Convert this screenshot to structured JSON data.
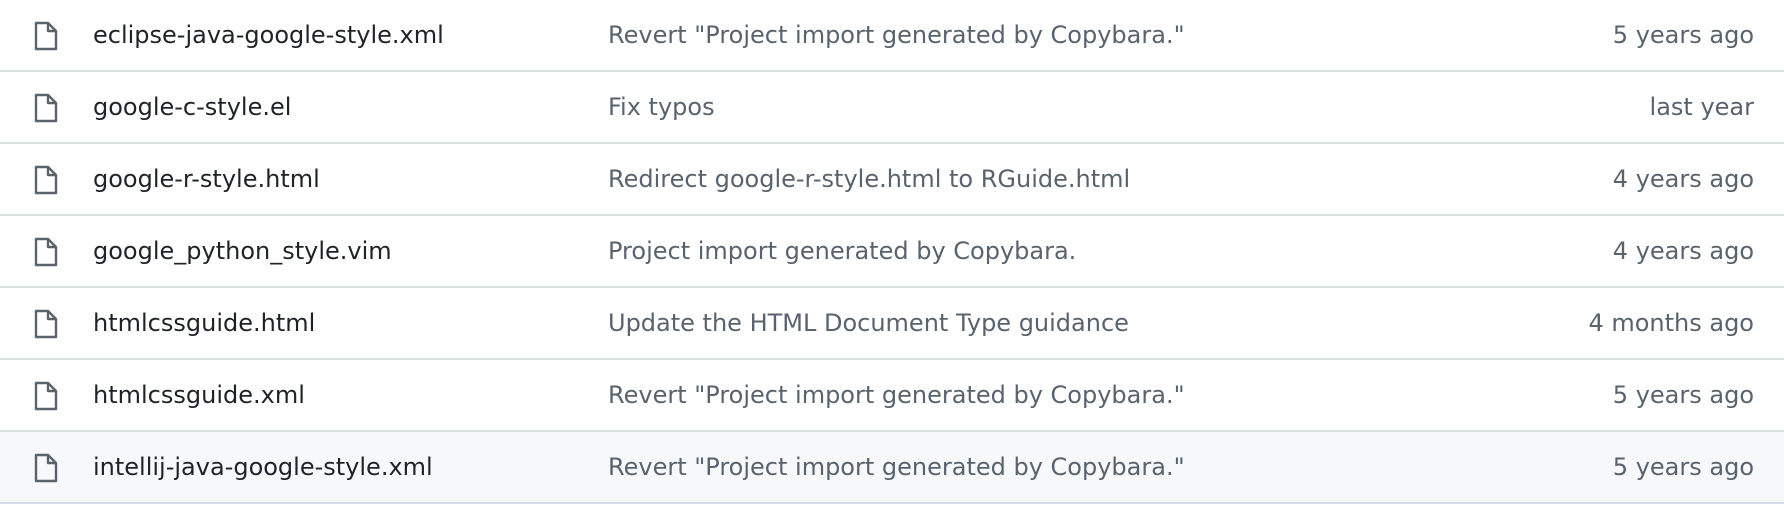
{
  "file_list": {
    "rows": [
      {
        "name": "eclipse-java-google-style.xml",
        "commit": "Revert \"Project import generated by Copybara.\"",
        "age": "5 years ago",
        "icon": "file-icon"
      },
      {
        "name": "google-c-style.el",
        "commit": "Fix typos",
        "age": "last year",
        "icon": "file-icon"
      },
      {
        "name": "google-r-style.html",
        "commit": "Redirect google-r-style.html to RGuide.html",
        "age": "4 years ago",
        "icon": "file-icon"
      },
      {
        "name": "google_python_style.vim",
        "commit": "Project import generated by Copybara.",
        "age": "4 years ago",
        "icon": "file-icon"
      },
      {
        "name": "htmlcssguide.html",
        "commit": "Update the HTML Document Type guidance",
        "age": "4 months ago",
        "icon": "file-icon"
      },
      {
        "name": "htmlcssguide.xml",
        "commit": "Revert \"Project import generated by Copybara.\"",
        "age": "5 years ago",
        "icon": "file-icon"
      },
      {
        "name": "intellij-java-google-style.xml",
        "commit": "Revert \"Project import generated by Copybara.\"",
        "age": "5 years ago",
        "icon": "file-icon"
      }
    ]
  },
  "colors": {
    "file_name": "#1f2328",
    "muted_text": "#59636e",
    "row_border": "#d8dee4",
    "hover_background": "#f6f8fa",
    "icon_stroke": "#59636e"
  }
}
